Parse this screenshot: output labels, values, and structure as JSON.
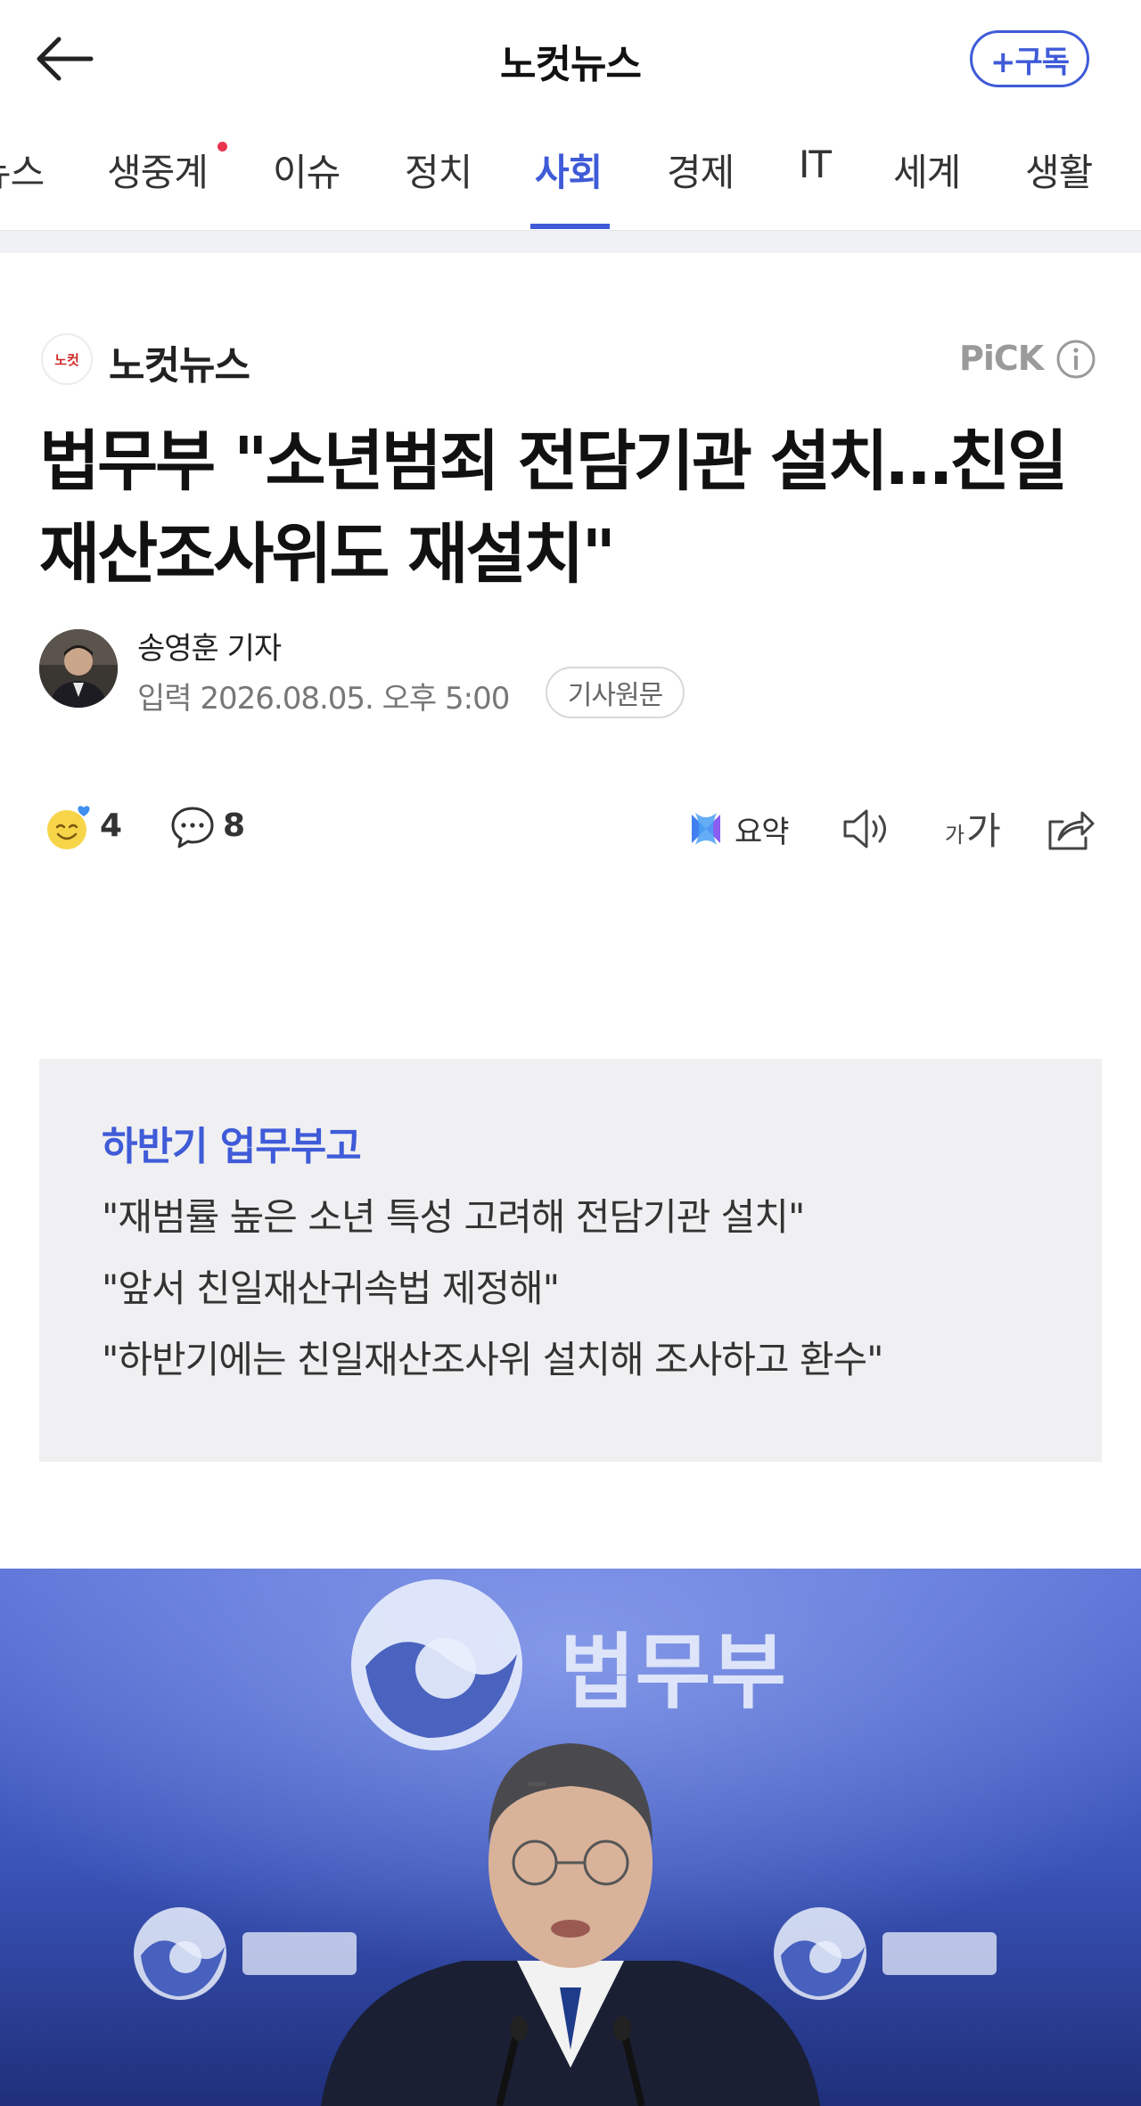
{
  "header": {
    "back_label": "뒤로",
    "title": "노컷뉴스",
    "subscribe_label": "+구독"
  },
  "tabs": [
    {
      "label": "뉴스"
    },
    {
      "label": "생중계"
    },
    {
      "label": "이슈"
    },
    {
      "label": "정치"
    },
    {
      "label": "사회"
    },
    {
      "label": "경제"
    },
    {
      "label": "IT"
    },
    {
      "label": "세계"
    },
    {
      "label": "생활"
    }
  ],
  "active_tab": "사회",
  "article": {
    "press_logo_text": "노컷",
    "press_name": "노컷뉴스",
    "pick_label": "PiCK",
    "headline_line1": "법무부 \"소년범죄 전담기관 설치…친일",
    "headline_line2": "재산조사위도 재설치\"",
    "reporter": "송영훈 기자",
    "date": "입력 2026.08.05. 오후 5:00",
    "original_label": "기사원문"
  },
  "actions": {
    "reaction_count": "4",
    "comment_count": "8",
    "summary_label": "요약",
    "font_small": "가",
    "font_big": "가"
  },
  "summary_box": {
    "heading": "하반기 업무부고",
    "lines": [
      "\"재범률 높은 소년 특성 고려해 전담기관 설치\"",
      "\"앞서 친일재산귀속법 제정해\"",
      "\"하반기에는 친일재산조사위 설치해 조사하고 환수\""
    ]
  },
  "photo": {
    "sign_text": "법무부"
  },
  "colors": {
    "accent": "#3f5bd8",
    "live_dot": "#e8344e",
    "summary_bg": "#f0f0f2",
    "press_red": "#d12a2a"
  },
  "icons": [
    "back-arrow-icon",
    "info-icon",
    "smile-reaction-icon",
    "comment-icon",
    "ai-summary-icon",
    "speaker-icon",
    "share-icon"
  ]
}
